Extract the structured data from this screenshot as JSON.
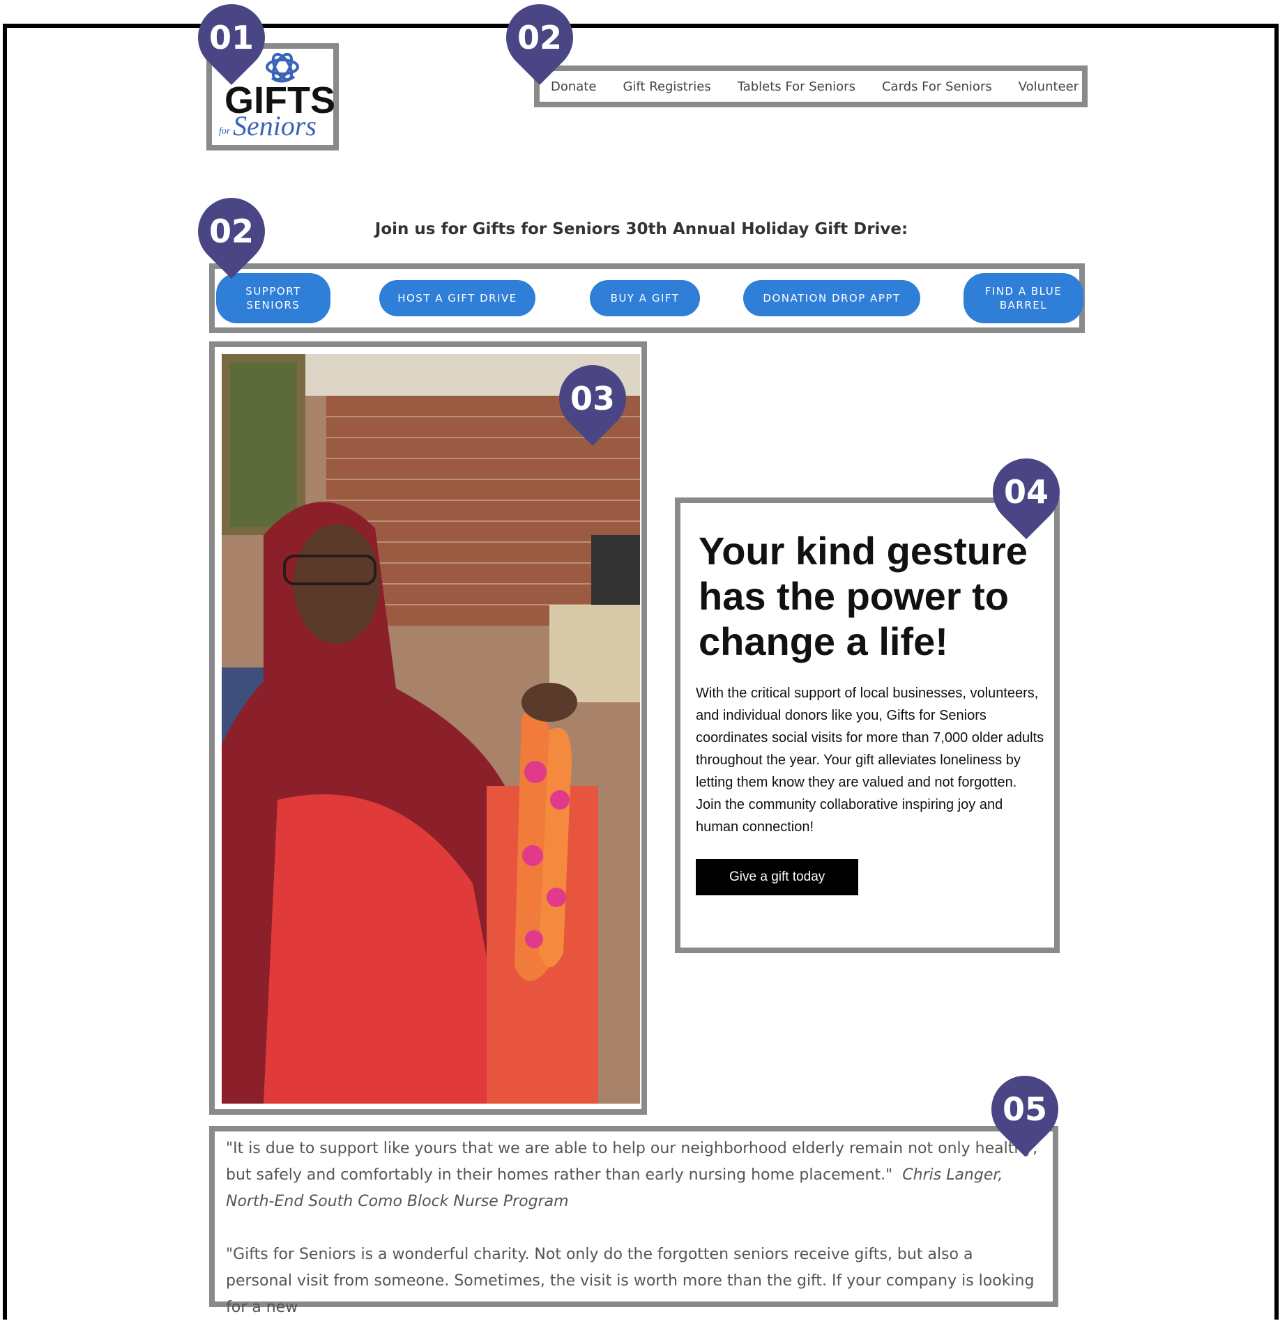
{
  "markers": [
    "01",
    "02",
    "02",
    "03",
    "04",
    "05"
  ],
  "logo": {
    "line1": "GIFTS",
    "line2": "for",
    "line3": "Seniors"
  },
  "nav": [
    "Donate",
    "Gift Registries",
    "Tablets For Seniors",
    "Cards For Seniors",
    "Volunteer"
  ],
  "join_heading": "Join us for Gifts for Seniors 30th Annual Holiday Gift Drive:",
  "buttons": {
    "support": [
      "SUPPORT",
      "SENIORS"
    ],
    "host": "HOST A GIFT DRIVE",
    "buy": "BUY A GIFT",
    "drop": "DONATION DROP APPT",
    "barrel": [
      "FIND A BLUE",
      "BARREL"
    ]
  },
  "card": {
    "heading": "Your kind gesture has the power to change a life!",
    "body": "With the critical support of local businesses, volunteers, and individual donors like you, Gifts for Seniors coordinates social visits for more than 7,000 older adults throughout the year.  Your gift alleviates loneliness by letting them know they are valued and not forgotten.  Join the community collaborative inspiring joy and human connection!",
    "cta": "Give a gift today"
  },
  "quotes": {
    "q1": "\"It is due to support like yours that we are able to help our neighborhood elderly remain not only healthy, but safely and comfortably in their homes rather than early nursing home placement.\"",
    "q1_author": "Chris Langer, North-End South Como Block Nurse Program",
    "q2": " \"Gifts for Seniors is a wonderful charity.  Not only do the forgotten seniors receive gifts, but also a personal visit from someone.  Sometimes, the visit is worth more than the gift.  If your company is looking for a new"
  },
  "colors": {
    "marker": "#4a4685",
    "pill": "#2f7ed8",
    "box_border": "#8a8a8a"
  }
}
